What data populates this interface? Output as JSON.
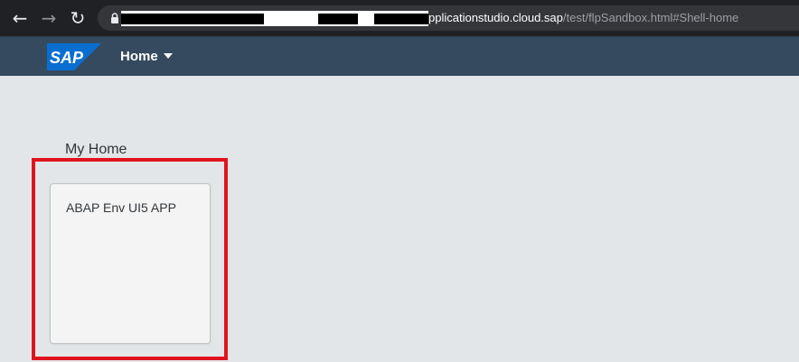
{
  "browser": {
    "back_icon": "arrow-left-icon",
    "forward_icon": "arrow-right-icon",
    "reload_icon": "reload-icon",
    "back_glyph": "←",
    "forward_glyph": "→",
    "reload_glyph": "↻",
    "url_host": "pplicationstudio.cloud.sap",
    "url_path": "/test/flpSandbox.html#Shell-home"
  },
  "shell": {
    "logo_text": "SAP",
    "home_label": "Home",
    "colors": {
      "header": "#354a5f",
      "logo_blue": "#0a6ed1"
    }
  },
  "home": {
    "section_title": "My Home",
    "tiles": [
      {
        "title": "ABAP Env UI5 APP"
      }
    ],
    "highlight_color": "#e0141e"
  }
}
